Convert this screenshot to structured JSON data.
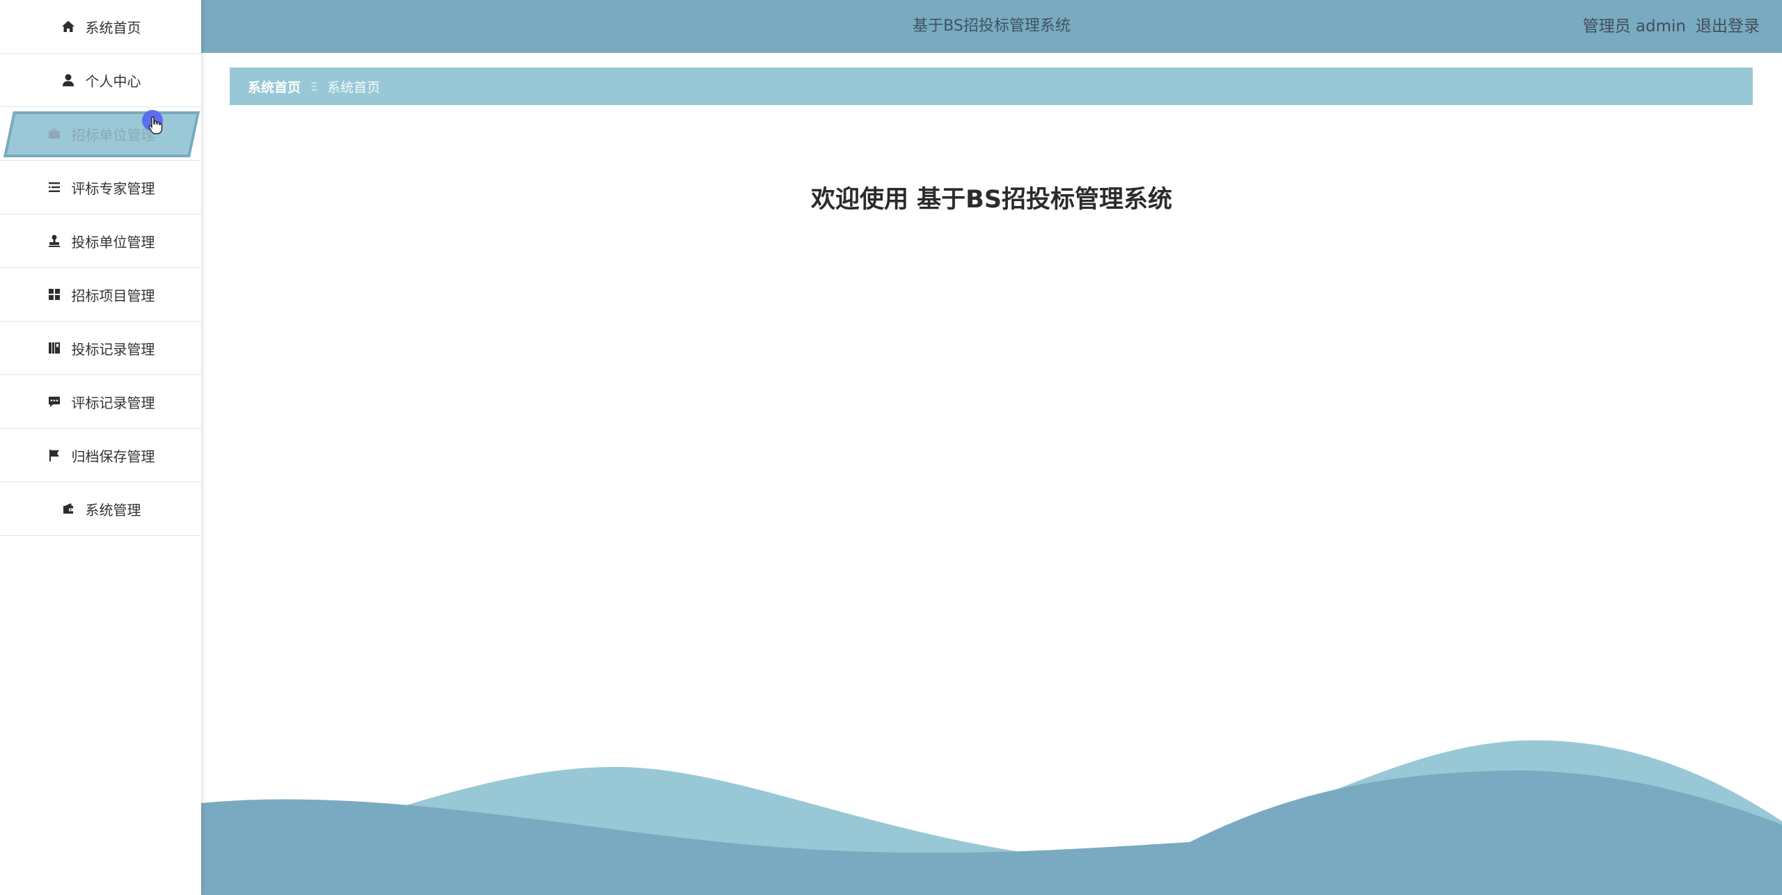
{
  "sidebar": {
    "items": [
      {
        "label": "系统首页",
        "icon": "home-icon"
      },
      {
        "label": "个人中心",
        "icon": "user-icon"
      },
      {
        "label": "招标单位管理",
        "icon": "briefcase-icon"
      },
      {
        "label": "评标专家管理",
        "icon": "list-indent-icon"
      },
      {
        "label": "投标单位管理",
        "icon": "stamp-icon"
      },
      {
        "label": "招标项目管理",
        "icon": "grid-icon"
      },
      {
        "label": "投标记录管理",
        "icon": "book-icon"
      },
      {
        "label": "评标记录管理",
        "icon": "comment-icon"
      },
      {
        "label": "归档保存管理",
        "icon": "flag-icon"
      },
      {
        "label": "系统管理",
        "icon": "wallet-icon"
      }
    ],
    "active_index": 2
  },
  "header": {
    "title": "基于BS招投标管理系统",
    "user_label": "管理员 admin",
    "logout_label": "退出登录"
  },
  "breadcrumb": {
    "home": "系统首页",
    "separator": "Ξ",
    "current": "系统首页"
  },
  "main": {
    "welcome": "欢迎使用 基于BS招投标管理系统"
  },
  "colors": {
    "header_bg": "#79aac1",
    "breadcrumb_bg": "#98c8d6",
    "wave_light": "#98c8d6",
    "wave_dark": "#79aac1",
    "cursor": "#5c6ef0"
  }
}
